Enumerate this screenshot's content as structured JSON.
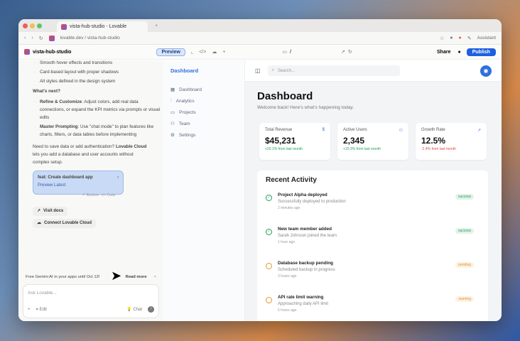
{
  "browser": {
    "tab_title": "vista-hub-studio - Lovable",
    "url": "lovable.dev / vista-hub-studio",
    "assistant": "Assistant"
  },
  "app": {
    "project": "vista-hub-studio",
    "preview": "Preview",
    "path": "/",
    "share": "Share",
    "publish": "Publish"
  },
  "chat": {
    "bullets_top": [
      "Smooth hover effects and transitions",
      "Card-based layout with proper shadows",
      "All styles defined in the design system"
    ],
    "next_heading": "What's next?",
    "next_items": [
      {
        "bold": "Refine & Customize",
        "text": ": Adjust colors, add real data connections, or expand the KPI metrics via prompts or visual edits"
      },
      {
        "bold": "Master Prompting",
        "text": ": Use \"chat mode\" to plan features like charts, filters, or data tables before implementing"
      }
    ],
    "cloud_pre": "Need to save data or add authentication? ",
    "cloud_bold": "Lovable Cloud",
    "cloud_post": " lets you add a database and user accounts without complex setup.",
    "commit": {
      "title": "feat: Create dashboard app",
      "sub": "Preview Latest",
      "restore": "Restore",
      "code": "Code"
    },
    "visit_docs": "Visit docs",
    "connect_cloud": "Connect Lovable Cloud",
    "promo": "Free Gemini AI in your apps until Oct 13!",
    "read_more": "Read more",
    "input_placeholder": "Ask Lovable...",
    "edit": "Edit",
    "chat_mode": "Chat"
  },
  "preview": {
    "brand": "Dashboard",
    "nav": [
      "Dashboard",
      "Analytics",
      "Projects",
      "Team",
      "Settings"
    ],
    "search_placeholder": "Search...",
    "title": "Dashboard",
    "subtitle": "Welcome back! Here's what's happening today.",
    "kpis": [
      {
        "label": "Total Revenue",
        "value": "$45,231",
        "change": "+20.1% from last month",
        "color": "#22a05a"
      },
      {
        "label": "Active Users",
        "value": "2,345",
        "change": "+15.3% from last month",
        "color": "#22a05a"
      },
      {
        "label": "Growth Rate",
        "value": "12.5%",
        "change": "-2.4% from last month",
        "color": "#e04848"
      }
    ],
    "activity_title": "Recent Activity",
    "activity": [
      {
        "title": "Project Alpha deployed",
        "desc": "Successfully deployed to production",
        "time": "2 minutes ago",
        "badge": "success",
        "color": "#22a05a"
      },
      {
        "title": "New team member added",
        "desc": "Sarah Johnson joined the team",
        "time": "1 hour ago",
        "badge": "success",
        "color": "#22a05a"
      },
      {
        "title": "Database backup pending",
        "desc": "Scheduled backup in progress",
        "time": "3 hours ago",
        "badge": "pending",
        "color": "#e8952a"
      },
      {
        "title": "API rate limit warning",
        "desc": "Approaching daily API limit",
        "time": "5 hours ago",
        "badge": "warning",
        "color": "#e8952a"
      }
    ]
  }
}
